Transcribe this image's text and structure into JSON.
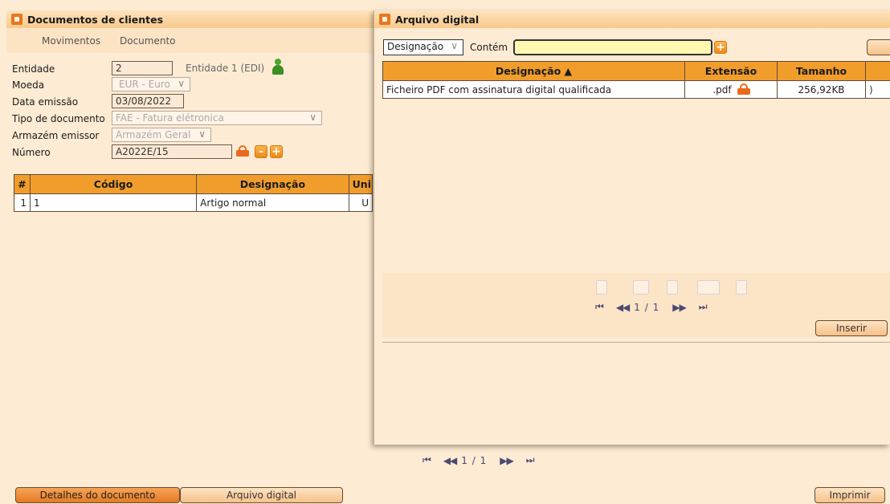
{
  "left": {
    "title": "Documentos de clientes",
    "menu": [
      "Movimentos",
      "Documento"
    ],
    "form": {
      "entidade_label": "Entidade",
      "entidade_value": "2",
      "entidade_name": "Entidade 1 (EDI)",
      "moeda_label": "Moeda",
      "moeda_value": "EUR - Euro",
      "data_label": "Data emissão",
      "data_value": "03/08/2022",
      "tipo_label": "Tipo de documento",
      "tipo_value": "FAE - Fatura elétronica",
      "armazem_label": "Armazém emissor",
      "armazem_value": "Armazém Geral",
      "numero_label": "Número",
      "numero_value": "A2022E/15"
    },
    "table": {
      "headers": [
        "#",
        "Código",
        "Designação",
        "Uni"
      ],
      "rows": [
        [
          "1",
          "1",
          "Artigo normal",
          "U"
        ]
      ]
    },
    "pager_text": "1 / 1",
    "tabs": [
      "Detalhes do documento",
      "Arquivo digital"
    ],
    "print_label": "Imprimir"
  },
  "right": {
    "title": "Arquivo digital",
    "filter_select": "Designação",
    "filter_label": "Contém",
    "filter_value": "",
    "table": {
      "headers": [
        "Designação ▲",
        "Extensão",
        "Tamanho"
      ],
      "rows": [
        [
          "Ficheiro PDF com assinatura digital qualificada",
          ".pdf",
          "256,92KB"
        ]
      ]
    },
    "pager_text": "1 / 1",
    "insert_label": "Inserir"
  },
  "colors": {
    "accent": "#f19d2c",
    "background": "#fdebd3",
    "lock": "#e86a1d",
    "user_icon": "#4aa82a"
  }
}
